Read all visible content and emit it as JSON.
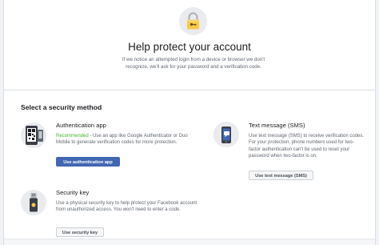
{
  "header": {
    "title": "Help protect your account",
    "description": "If we notice an attempted login from a device or browser we don't recognize, we'll ask for your password and a verification code."
  },
  "section_title": "Select a security method",
  "methods": [
    {
      "title": "Authentication app",
      "recommended": "Recommended",
      "description": " - Use an app like Google Authenticator or Duo Mobile to generate verification codes for more protection.",
      "button": "Use authentication app",
      "icon": "qr-phone-icon"
    },
    {
      "title": "Text message (SMS)",
      "description": "Use text message (SMS) to receive verification codes. For your protection, phone numbers used for two-factor authentication can't be used to reset your password when two-factor is on.",
      "button": "Use text message (SMS)",
      "icon": "sms-phone-icon"
    },
    {
      "title": "Security key",
      "description": "Use a physical security key to help protect your Facebook account from unauthorized access. You won't need to enter a code.",
      "button": "Use security key",
      "icon": "usb-key-icon"
    }
  ],
  "colors": {
    "primary_button": "#4267b2",
    "recommended": "#42b72a",
    "page_background": "#f0f2f5"
  }
}
